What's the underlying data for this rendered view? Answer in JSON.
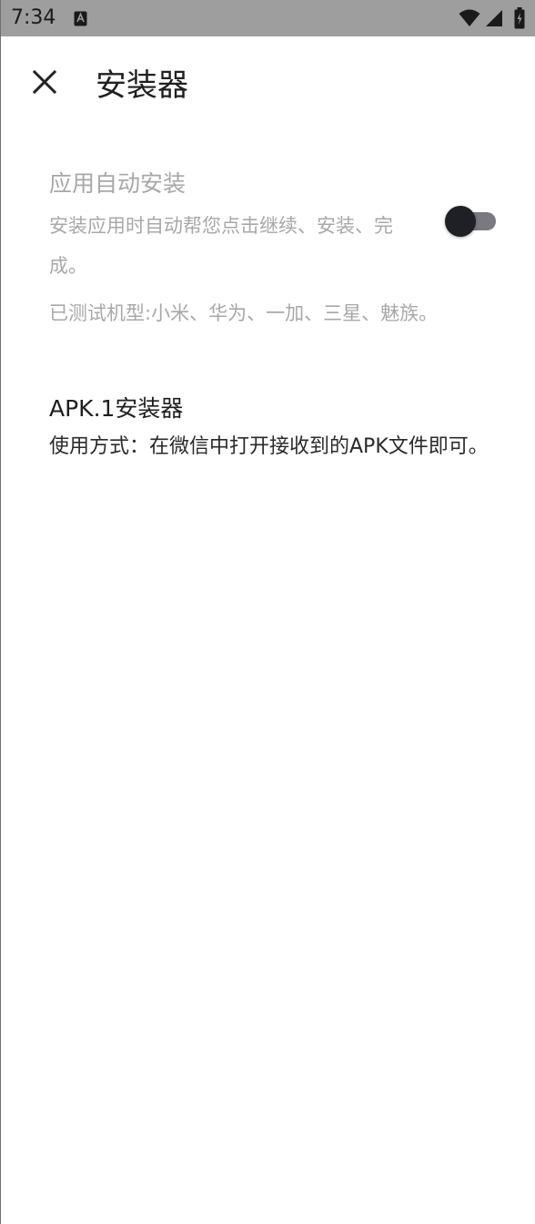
{
  "status_bar": {
    "time": "7:34",
    "background": "#9e9e9e",
    "icons": [
      "notification-a-icon",
      "wifi-icon",
      "signal-icon",
      "battery-charging-icon"
    ]
  },
  "toolbar": {
    "close_icon": "close-icon",
    "title": "安装器"
  },
  "auto_install": {
    "title": "应用自动安装",
    "summary": "安装应用时自动帮您点击继续、安装、完成。",
    "note": "已测试机型:小米、华为、一加、三星、魅族。",
    "enabled": false
  },
  "info": {
    "title": "APK.1安装器",
    "body": "使用方式：在微信中打开接收到的APK文件即可。"
  }
}
